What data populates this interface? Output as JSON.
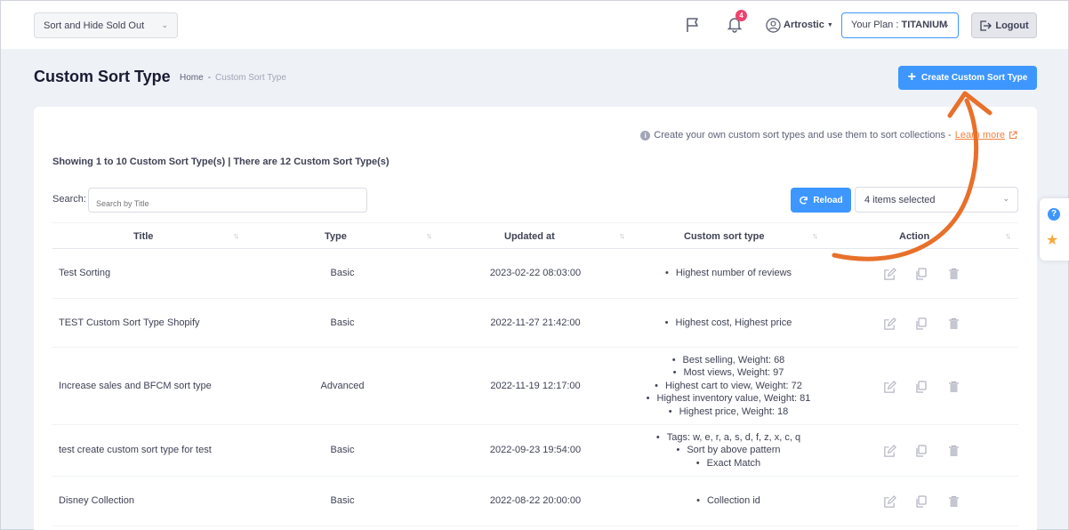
{
  "topbar": {
    "store_select": "Sort and Hide Sold Out",
    "notifications_count": "4",
    "user_name": "Artrostic",
    "plan_prefix": "Your Plan : ",
    "plan_name": "TITANIUM",
    "logout_label": "Logout"
  },
  "page": {
    "title": "Custom Sort Type",
    "breadcrumb_home": "Home",
    "breadcrumb_sep": "-",
    "breadcrumb_current": "Custom Sort Type",
    "create_button": "Create Custom Sort Type"
  },
  "card": {
    "info_text": "Create your own custom sort types and use them to sort collections -",
    "learn_more": "Learn more",
    "showing_text": "Showing 1 to 10 Custom Sort Type(s) | There are 12 Custom Sort Type(s)",
    "search_label": "Search:",
    "search_placeholder": "Search by Title",
    "reload_label": "Reload",
    "columns_select": "4 items selected"
  },
  "table": {
    "headers": {
      "title": "Title",
      "type": "Type",
      "updated": "Updated at",
      "custom": "Custom sort type",
      "action": "Action"
    },
    "rows": [
      {
        "title": "Test Sorting",
        "type": "Basic",
        "updated": "2023-02-22 08:03:00",
        "custom": [
          "Highest number of reviews"
        ]
      },
      {
        "title": "TEST Custom Sort Type Shopify",
        "type": "Basic",
        "updated": "2022-11-27 21:42:00",
        "custom": [
          "Highest cost, Highest price"
        ]
      },
      {
        "title": "Increase sales and BFCM sort type",
        "type": "Advanced",
        "updated": "2022-11-19 12:17:00",
        "custom": [
          "Best selling, Weight: 68",
          "Most views, Weight: 97",
          "Highest cart to view, Weight: 72",
          "Highest inventory value, Weight: 81",
          "Highest price, Weight: 18"
        ]
      },
      {
        "title": "test create custom sort type for test",
        "type": "Basic",
        "updated": "2022-09-23 19:54:00",
        "custom": [
          "Tags: w, e, r, a, s, d, f, z, x, c, q",
          "Sort by above pattern",
          "Exact Match"
        ]
      },
      {
        "title": "Disney Collection",
        "type": "Basic",
        "updated": "2022-08-22 20:00:00",
        "custom": [
          "Collection id"
        ]
      }
    ]
  },
  "colors": {
    "primary": "#3e97ff",
    "annotation_arrow": "#e8702a",
    "badge": "#f1416c"
  }
}
